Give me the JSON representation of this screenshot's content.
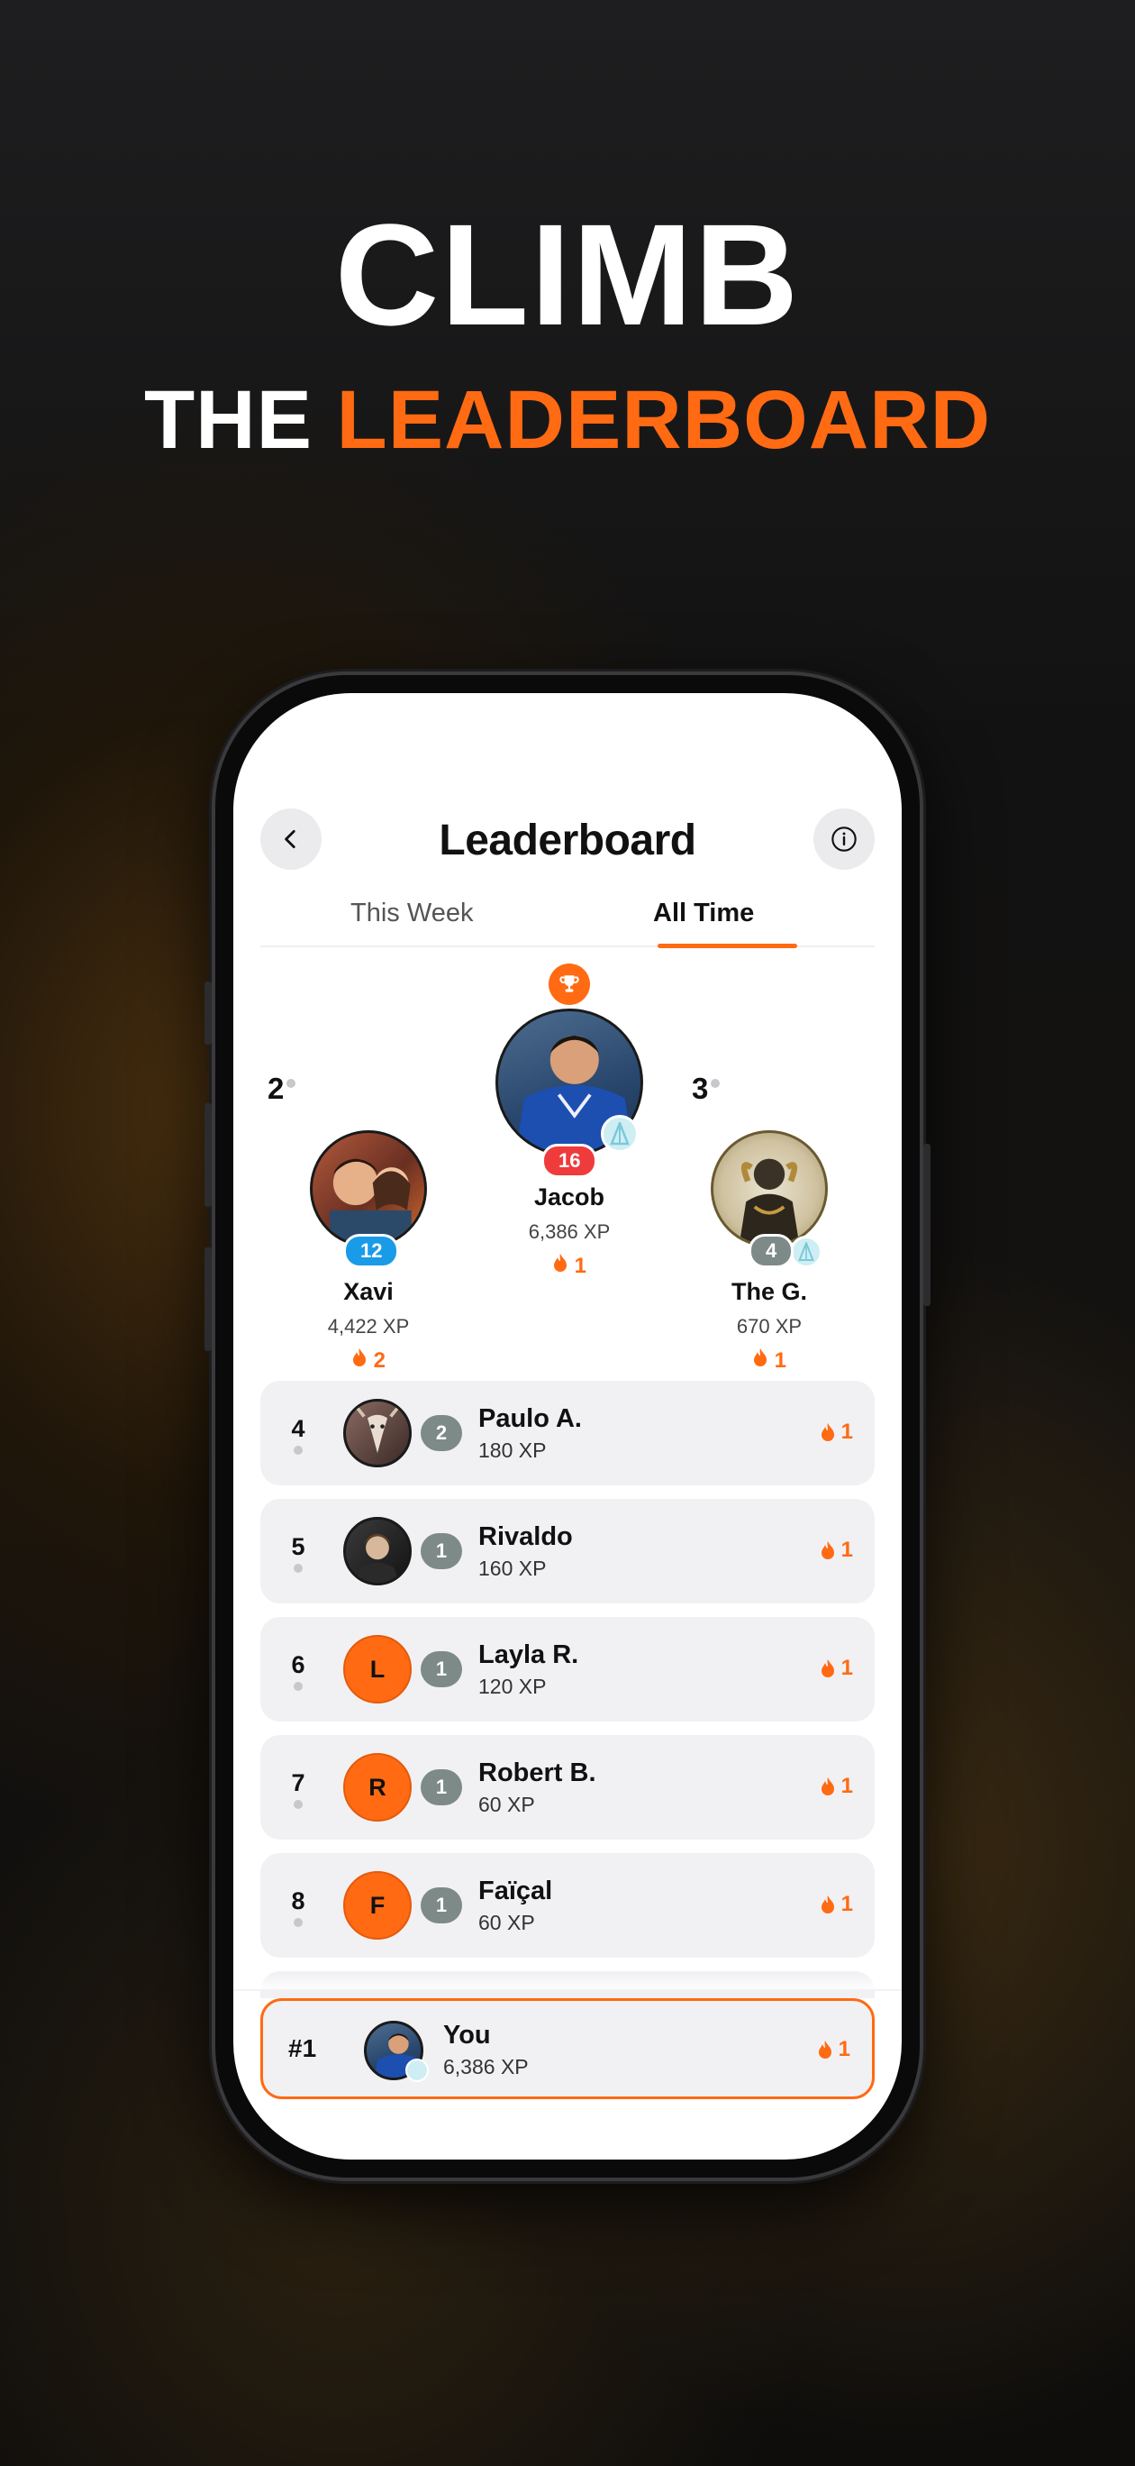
{
  "promo": {
    "headline": "CLIMB",
    "sub_prefix": "THE ",
    "sub_accent": "LEADERBOARD"
  },
  "colors": {
    "accent": "#ff6a13",
    "level_red": "#ef3b3b",
    "level_blue": "#1a9be8",
    "level_gray": "#7d8a88"
  },
  "header": {
    "title": "Leaderboard",
    "back_icon": "chevron-left-icon",
    "info_icon": "info-icon"
  },
  "tabs": [
    {
      "label": "This Week",
      "active": false
    },
    {
      "label": "All Time",
      "active": true
    }
  ],
  "podium": {
    "first": {
      "name": "Jacob",
      "xp": "6,386 XP",
      "level": "16",
      "streak": "1"
    },
    "second": {
      "rank": "2",
      "name": "Xavi",
      "xp": "4,422 XP",
      "level": "12",
      "streak": "2"
    },
    "third": {
      "rank": "3",
      "name": "The G.",
      "xp": "670 XP",
      "level": "4",
      "streak": "1"
    }
  },
  "rows": [
    {
      "rank": "4",
      "avatar": "photo-goat",
      "level": "2",
      "name": "Paulo A.",
      "xp": "180 XP",
      "streak": "1"
    },
    {
      "rank": "5",
      "avatar": "photo-man",
      "level": "1",
      "name": "Rivaldo",
      "xp": "160 XP",
      "streak": "1"
    },
    {
      "rank": "6",
      "avatar_letter": "L",
      "level": "1",
      "name": "Layla R.",
      "xp": "120 XP",
      "streak": "1"
    },
    {
      "rank": "7",
      "avatar_letter": "R",
      "level": "1",
      "name": "Robert B.",
      "xp": "60 XP",
      "streak": "1"
    },
    {
      "rank": "8",
      "avatar_letter": "F",
      "level": "1",
      "name": "Faïçal",
      "xp": "60 XP",
      "streak": "1"
    }
  ],
  "you": {
    "rank": "#1",
    "name": "You",
    "xp": "6,386 XP",
    "streak": "1"
  }
}
